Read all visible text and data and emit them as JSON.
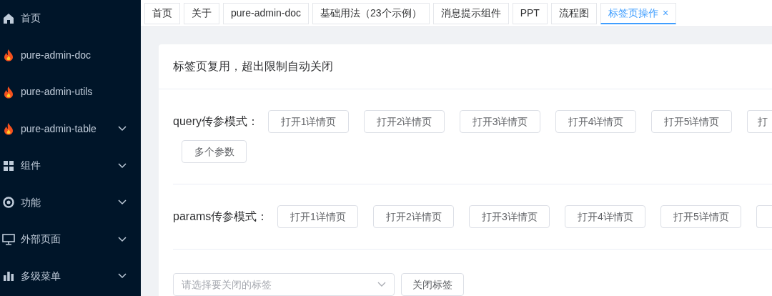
{
  "sidebar": {
    "items": [
      {
        "label": "首页",
        "kind": "home",
        "expandable": false
      },
      {
        "label": "pure-admin-doc",
        "kind": "fire",
        "expandable": false
      },
      {
        "label": "pure-admin-utils",
        "kind": "fire",
        "expandable": false
      },
      {
        "label": "pure-admin-table",
        "kind": "fire",
        "expandable": true
      },
      {
        "label": "组件",
        "kind": "grid",
        "expandable": true
      },
      {
        "label": "功能",
        "kind": "ring",
        "expandable": true
      },
      {
        "label": "外部页面",
        "kind": "monitor",
        "expandable": true
      },
      {
        "label": "多级菜单",
        "kind": "bars",
        "expandable": true
      }
    ]
  },
  "tabs": [
    {
      "label": "首页",
      "selected": false
    },
    {
      "label": "关于",
      "selected": false
    },
    {
      "label": "pure-admin-doc",
      "selected": false
    },
    {
      "label": "基础用法（23个示例）",
      "selected": false
    },
    {
      "label": "消息提示组件",
      "selected": false
    },
    {
      "label": "PPT",
      "selected": false
    },
    {
      "label": "流程图",
      "selected": false
    },
    {
      "label": "标签页操作",
      "selected": true,
      "close": "×"
    }
  ],
  "card": {
    "title": "标签页复用，超出限制自动关闭",
    "sections": [
      {
        "label": "query传参模式：",
        "buttons": [
          "打开1详情页",
          "打开2详情页",
          "打开3详情页",
          "打开4详情页",
          "打开5详情页",
          "打",
          "多个参数"
        ]
      },
      {
        "label": "params传参模式：",
        "buttons": [
          "打开1详情页",
          "打开2详情页",
          "打开3详情页",
          "打开4详情页",
          "打开5详情页"
        ]
      }
    ],
    "select": {
      "placeholder": "请选择要关闭的标签"
    },
    "close_button": "关闭标签"
  }
}
